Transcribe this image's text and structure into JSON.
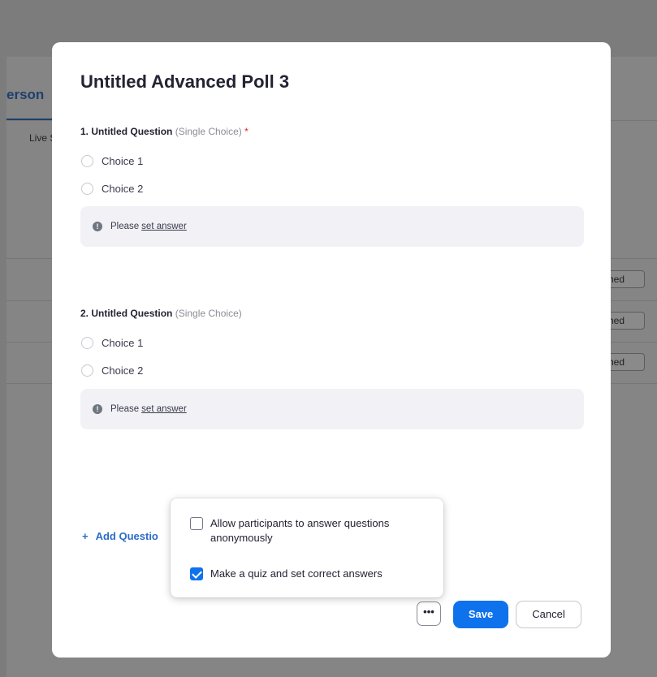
{
  "background": {
    "tab_label": "erson",
    "sub_label": "Live St",
    "row_badges": [
      "hed",
      "hed",
      "hed"
    ]
  },
  "modal": {
    "title": "Untitled Advanced Poll 3",
    "questions": [
      {
        "number": "1.",
        "title": "Untitled Question",
        "type": "(Single Choice)",
        "required_marker": "*",
        "choices": [
          "Choice 1",
          "Choice 2"
        ],
        "answer_prompt": "Please",
        "answer_link": "set answer"
      },
      {
        "number": "2.",
        "title": "Untitled Question",
        "type": "(Single Choice)",
        "required_marker": "",
        "choices": [
          "Choice 1",
          "Choice 2"
        ],
        "answer_prompt": "Please",
        "answer_link": "set answer"
      }
    ],
    "add_question_label": "Add Questio",
    "more_button_label": "•••",
    "save_label": "Save",
    "cancel_label": "Cancel"
  },
  "options_popover": {
    "items": [
      {
        "label": "Allow participants to answer questions anonymously",
        "checked": false
      },
      {
        "label": "Make a quiz and set correct answers",
        "checked": true
      }
    ]
  },
  "colors": {
    "accent": "#0e72ed",
    "link": "#2d6cc8",
    "required": "#e02828",
    "overlay": "#7c7c7c"
  }
}
